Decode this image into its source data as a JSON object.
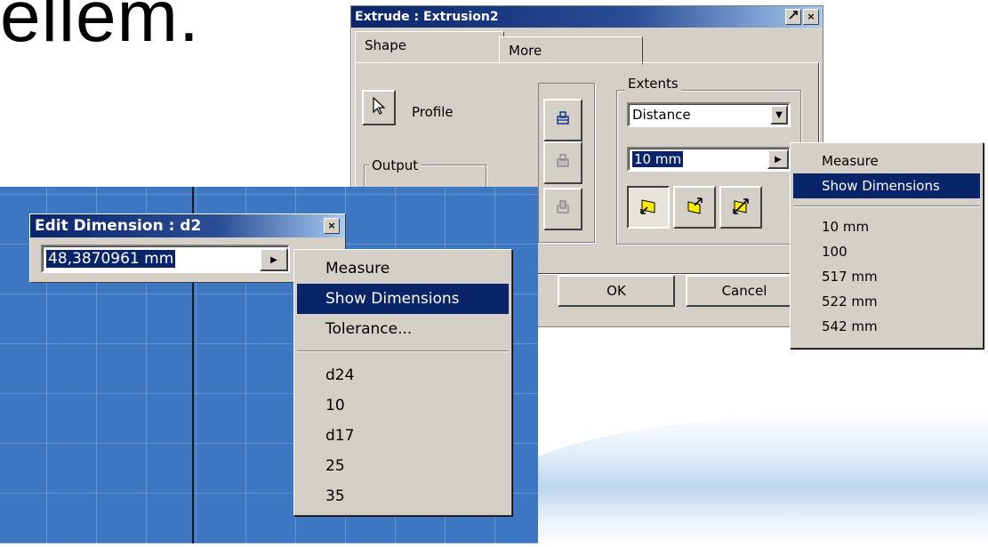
{
  "background": {
    "title_fragment": "ellem.",
    "accent": "#3d77c2"
  },
  "extrude_dialog": {
    "title": "Extrude : Extrusion2",
    "close_glyph": "×",
    "help_glyph": "?",
    "tabs": [
      "Shape",
      "More"
    ],
    "profile_label": "Profile",
    "output_label": "Output",
    "extents_label": "Extents",
    "extents_select": "Distance",
    "distance_value": "10 mm",
    "ok_label": "OK",
    "cancel_label": "Cancel"
  },
  "extrude_menu": {
    "items": [
      "Measure",
      "Show Dimensions"
    ],
    "highlighted": "Show Dimensions",
    "recent": [
      "10 mm",
      "100",
      "517 mm",
      "522 mm",
      "542 mm"
    ]
  },
  "edit_dimension": {
    "title": "Edit Dimension : d2",
    "value": "48,3870961 mm",
    "close_glyph": "×"
  },
  "edit_menu": {
    "items": [
      "Measure",
      "Show Dimensions",
      "Tolerance..."
    ],
    "highlighted": "Show Dimensions",
    "recent": [
      "d24",
      "10",
      "d17",
      "25",
      "35"
    ]
  },
  "colors": {
    "title_bar": "#0a246a",
    "dialog_face": "#d4d0c8",
    "highlight": "#0a246a"
  }
}
